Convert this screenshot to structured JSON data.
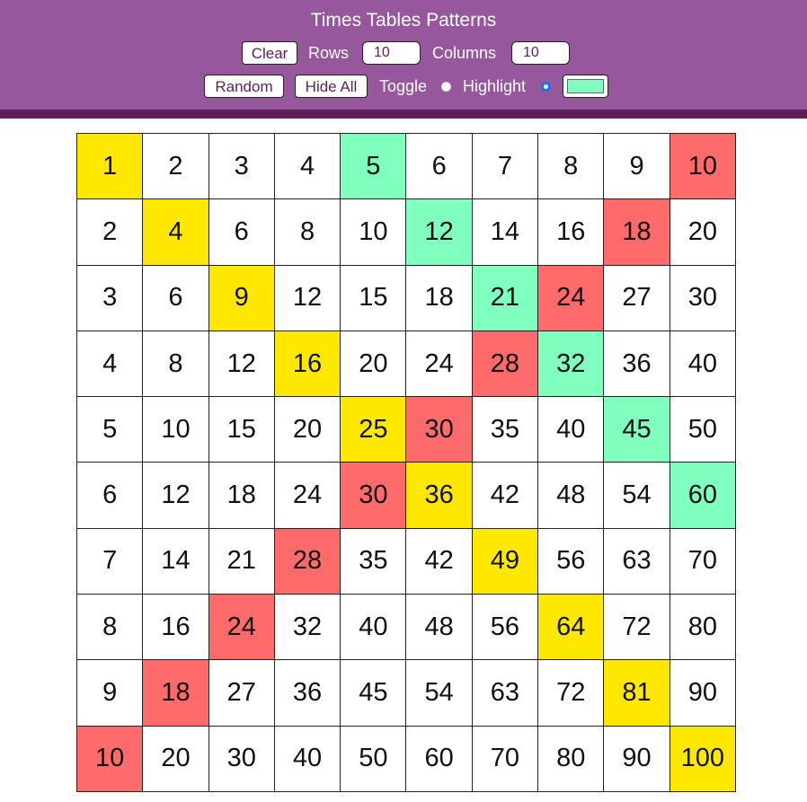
{
  "header": {
    "title": "Times Tables Patterns",
    "clear_label": "Clear",
    "rows_label": "Rows",
    "rows_value": "10",
    "columns_label": "Columns",
    "columns_value": "10",
    "random_label": "Random",
    "hide_all_label": "Hide All",
    "toggle_label": "Toggle",
    "highlight_label": "Highlight",
    "mode_selected": "highlight",
    "highlight_color": "#80ffbf"
  },
  "colors": {
    "header_bg": "#96579c",
    "header_bar": "#5c1f5a",
    "yellow": "#ffe800",
    "green": "#80ffbf",
    "red": "#ff6b6b"
  },
  "grid": {
    "rows": [
      [
        "1",
        "2",
        "3",
        "4",
        "5",
        "6",
        "7",
        "8",
        "9",
        "10"
      ],
      [
        "2",
        "4",
        "6",
        "8",
        "10",
        "12",
        "14",
        "16",
        "18",
        "20"
      ],
      [
        "3",
        "6",
        "9",
        "12",
        "15",
        "18",
        "21",
        "24",
        "27",
        "30"
      ],
      [
        "4",
        "8",
        "12",
        "16",
        "20",
        "24",
        "28",
        "32",
        "36",
        "40"
      ],
      [
        "5",
        "10",
        "15",
        "20",
        "25",
        "30",
        "35",
        "40",
        "45",
        "50"
      ],
      [
        "6",
        "12",
        "18",
        "24",
        "30",
        "36",
        "42",
        "48",
        "54",
        "60"
      ],
      [
        "7",
        "14",
        "21",
        "28",
        "35",
        "42",
        "49",
        "56",
        "63",
        "70"
      ],
      [
        "8",
        "16",
        "24",
        "32",
        "40",
        "48",
        "56",
        "64",
        "72",
        "80"
      ],
      [
        "9",
        "18",
        "27",
        "36",
        "45",
        "54",
        "63",
        "72",
        "81",
        "90"
      ],
      [
        "10",
        "20",
        "30",
        "40",
        "50",
        "60",
        "70",
        "80",
        "90",
        "100"
      ]
    ],
    "highlights": [
      [
        "yellow",
        "",
        "",
        "",
        "green",
        "",
        "",
        "",
        "",
        "red"
      ],
      [
        "",
        "yellow",
        "",
        "",
        "",
        "green",
        "",
        "",
        "red",
        ""
      ],
      [
        "",
        "",
        "yellow",
        "",
        "",
        "",
        "green",
        "red",
        "",
        ""
      ],
      [
        "",
        "",
        "",
        "yellow",
        "",
        "",
        "red",
        "green",
        "",
        ""
      ],
      [
        "",
        "",
        "",
        "",
        "yellow",
        "red",
        "",
        "",
        "green",
        ""
      ],
      [
        "",
        "",
        "",
        "",
        "red",
        "yellow",
        "",
        "",
        "",
        "green"
      ],
      [
        "",
        "",
        "",
        "red",
        "",
        "",
        "yellow",
        "",
        "",
        ""
      ],
      [
        "",
        "",
        "red",
        "",
        "",
        "",
        "",
        "yellow",
        "",
        ""
      ],
      [
        "",
        "red",
        "",
        "",
        "",
        "",
        "",
        "",
        "yellow",
        ""
      ],
      [
        "red",
        "",
        "",
        "",
        "",
        "",
        "",
        "",
        "",
        "yellow"
      ]
    ]
  }
}
